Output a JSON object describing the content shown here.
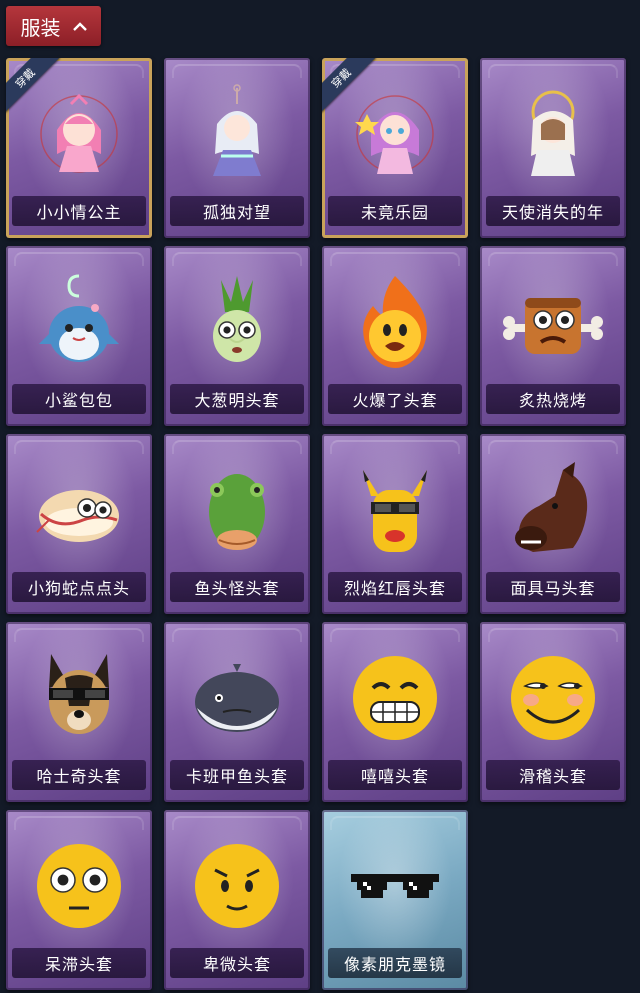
{
  "header": {
    "title": "服装"
  },
  "items": [
    {
      "name": "小小情公主",
      "icon": "pink-princess-figure",
      "badge": "穿戴"
    },
    {
      "name": "孤独对望",
      "icon": "white-haired-figure-keychain"
    },
    {
      "name": "未竟乐园",
      "icon": "pink-haired-figure",
      "badge": "穿戴"
    },
    {
      "name": "天使消失的年",
      "icon": "angel-veil-figure"
    },
    {
      "name": "小鲨包包",
      "icon": "shark-bag"
    },
    {
      "name": "大葱明头套",
      "icon": "green-onion-head"
    },
    {
      "name": "火爆了头套",
      "icon": "fire-head"
    },
    {
      "name": "炙热烧烤",
      "icon": "grilled-meat-head"
    },
    {
      "name": "小狗蛇点点头",
      "icon": "snake-head"
    },
    {
      "name": "鱼头怪头套",
      "icon": "fish-head"
    },
    {
      "name": "烈焰红唇头套",
      "icon": "yellow-mask-sunglasses"
    },
    {
      "name": "面具马头套",
      "icon": "horse-head"
    },
    {
      "name": "哈士奇头套",
      "icon": "dog-head-sunglasses"
    },
    {
      "name": "卡班甲鱼头套",
      "icon": "whale-head"
    },
    {
      "name": "嘻嘻头套",
      "icon": "grin-emoji"
    },
    {
      "name": "滑稽头套",
      "icon": "funny-emoji"
    },
    {
      "name": "呆滞头套",
      "icon": "stare-emoji"
    },
    {
      "name": "卑微头套",
      "icon": "humble-emoji"
    },
    {
      "name": "像素朋克墨镜",
      "icon": "pixel-sunglasses",
      "variant": "blue"
    }
  ]
}
